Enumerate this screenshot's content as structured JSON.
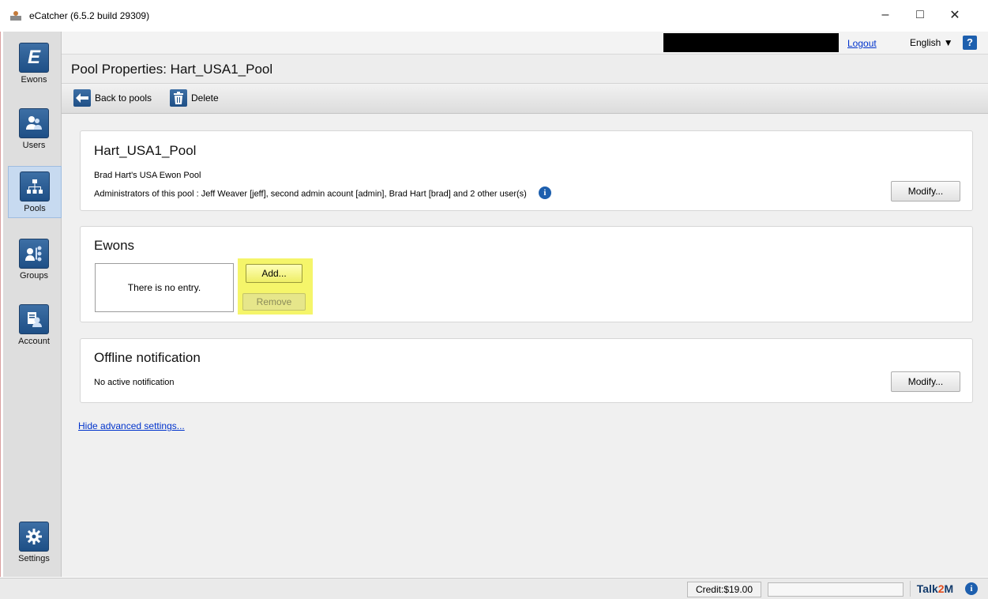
{
  "window": {
    "title": "eCatcher (6.5.2 build 29309)",
    "minimize": "–",
    "maximize": "□",
    "close": "✕"
  },
  "topbar": {
    "logout_label": "Logout",
    "language_label": "English ▼",
    "help_label": "?"
  },
  "sidebar": {
    "items": [
      {
        "label": "Ewons",
        "icon": "ewon-logo-icon"
      },
      {
        "label": "Users",
        "icon": "users-icon"
      },
      {
        "label": "Pools",
        "icon": "pools-icon",
        "active": true
      },
      {
        "label": "Groups",
        "icon": "groups-icon"
      },
      {
        "label": "Account",
        "icon": "account-icon"
      },
      {
        "label": "Settings",
        "icon": "gear-icon"
      }
    ]
  },
  "header": {
    "title": "Pool Properties: Hart_USA1_Pool"
  },
  "toolbar": {
    "back_label": "Back to pools",
    "delete_label": "Delete"
  },
  "pool_panel": {
    "name": "Hart_USA1_Pool",
    "description": "Brad Hart's USA Ewon Pool",
    "administrators": "Administrators of this pool : Jeff Weaver [jeff], second admin acount [admin], Brad Hart [brad] and 2 other user(s)",
    "modify_label": "Modify..."
  },
  "ewons_panel": {
    "title": "Ewons",
    "empty_text": "There is no entry.",
    "add_label": "Add...",
    "remove_label": "Remove"
  },
  "offline_panel": {
    "title": "Offline notification",
    "status": "No active notification",
    "modify_label": "Modify..."
  },
  "advanced_link": "Hide advanced settings...",
  "statusbar": {
    "credit": "Credit:$19.00",
    "brand_a": "Talk",
    "brand_b": "2",
    "brand_c": "M"
  },
  "colors": {
    "accent_blue": "#1e4f86",
    "highlight_yellow": "#f5f56a",
    "link_blue": "#0033cc"
  }
}
